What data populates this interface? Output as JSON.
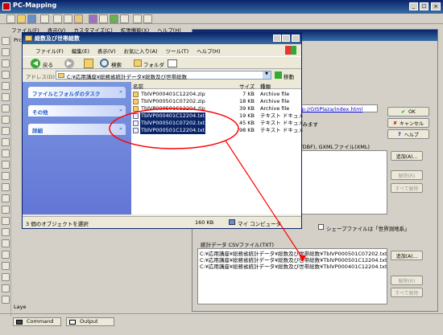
{
  "app": {
    "title": "PC-Mapping",
    "controls": [
      "_",
      "□",
      "×"
    ],
    "menu": [
      "ファイル(F)",
      "表示(V)",
      "カスタマイズ(C)",
      "拡張機能(X)",
      "ヘルプ(H)"
    ],
    "side_label": "Prc",
    "left_label": "Laye"
  },
  "dialog": {
    "url": "tp://GISPlaza/index.html",
    "line2": "込みます",
    "xml_label": "X/DBF), GXMLファイル(XML)",
    "ok": "OK",
    "cancel": "キャンセル",
    "help": "ヘルプ",
    "add": "追加(A)...",
    "remove": "解除(R)",
    "remove_all": "すべて解除",
    "shape_label": "シェープファイルは「世界測地系」",
    "csv_label": "統計データ CSVファイル(TXT)",
    "csv_lines": [
      "C:¥応用講座¥総務省統計データ¥総数及び世帯総数¥TblVP000501C07202.txt",
      "C:¥応用講座¥総務省統計データ¥総数及び世帯総数¥TblVP000501C12204.txt",
      "C:¥応用講座¥総務省統計データ¥総数及び世帯総数¥TblVP000401C12204.txt"
    ],
    "add2": "追加(A)...",
    "remove2": "解除(R)",
    "remove_all2": "すべて解除"
  },
  "explorer": {
    "title": "総数及び世帯総数",
    "menu": [
      "ファイル(F)",
      "編集(E)",
      "表示(V)",
      "お気に入り(A)",
      "ツール(T)",
      "ヘルプ(H)"
    ],
    "back": "戻る",
    "search": "検索",
    "folders": "フォルダ",
    "address_label": "アドレス(D)",
    "address": "C:¥応用講座¥総務省統計データ¥総数及び世帯総数",
    "go": "移動",
    "panel_tasks": "ファイルとフォルダのタスク",
    "panel_other": "その他",
    "panel_details": "詳細",
    "columns": [
      "名前",
      "サイズ",
      "種類"
    ],
    "files": [
      {
        "name": "TblVP000401C12204.zip",
        "size": "7 KB",
        "type": "Archive file",
        "sel": false
      },
      {
        "name": "TblVP000501C07202.zip",
        "size": "18 KB",
        "type": "Archive file",
        "sel": false
      },
      {
        "name": "TblVP000501C12204.zip",
        "size": "39 KB",
        "type": "Archive file",
        "sel": false
      },
      {
        "name": "TblVP000401C12204.txt",
        "size": "19 KB",
        "type": "テキスト ドキュメ",
        "sel": true
      },
      {
        "name": "TblVP000501C07202.txt",
        "size": "45 KB",
        "type": "テキスト ドキュメ",
        "sel": true
      },
      {
        "name": "TblVP000501C12204.txt",
        "size": "98 KB",
        "type": "テキスト ドキュメ",
        "sel": true
      }
    ],
    "status": "3 個のオブジェクトを選択",
    "status_size": "160 KB",
    "status_loc": "マイ コンピュータ"
  },
  "bottom_tabs": [
    "Command",
    "Output"
  ],
  "colors": {
    "title_bar": "#0a246a",
    "selection": "#0a246a",
    "annotation": "#ff0000"
  }
}
